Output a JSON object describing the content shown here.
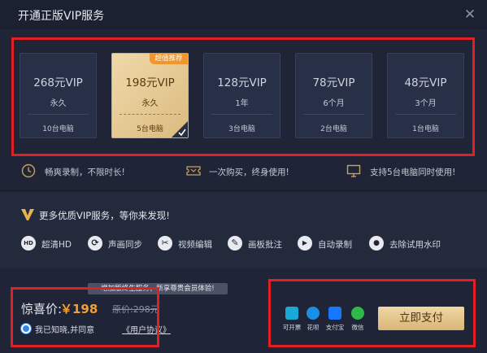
{
  "dialog": {
    "title": "开通正版VIP服务",
    "close_glyph": "✕"
  },
  "plans": [
    {
      "price": "268元VIP",
      "duration": "永久",
      "computers": "10台电脑",
      "selected": false
    },
    {
      "price": "198元VIP",
      "duration": "永久",
      "computers": "5台电脑",
      "selected": true,
      "badge": "超值推荐"
    },
    {
      "price": "128元VIP",
      "duration": "1年",
      "computers": "3台电脑",
      "selected": false
    },
    {
      "price": "78元VIP",
      "duration": "6个月",
      "computers": "2台电脑",
      "selected": false
    },
    {
      "price": "48元VIP",
      "duration": "3个月",
      "computers": "1台电脑",
      "selected": false
    }
  ],
  "highlights": [
    {
      "icon": "clock-icon",
      "text": "畅爽录制，不限时长!"
    },
    {
      "icon": "ticket-icon",
      "text": "一次购买，终身使用!"
    },
    {
      "icon": "monitor-icon",
      "text": "支持5台电脑同时使用!"
    }
  ],
  "more": {
    "title": "更多优质VIP服务，等你来发现!",
    "features": [
      {
        "icon": "hd-icon",
        "glyph": "HD",
        "label": "超清HD"
      },
      {
        "icon": "sync-icon",
        "glyph": "⟳",
        "label": "声画同步"
      },
      {
        "icon": "scissors-icon",
        "glyph": "✂",
        "label": "视频编辑"
      },
      {
        "icon": "brush-icon",
        "glyph": "✎",
        "label": "画板批注"
      },
      {
        "icon": "play-icon",
        "glyph": "▶",
        "label": "自动录制"
      },
      {
        "icon": "water-drop-icon",
        "glyph": "●",
        "label": "去除试用水印"
      }
    ]
  },
  "checkout": {
    "tooltip": "增加版终生服务，新享尊贵会员体验!",
    "surprise_label": "惊喜价:",
    "current_price": "￥198",
    "original_price": "原价:298元",
    "agree_text": "我已知晓,并同意",
    "agreement_link": "《用户协议》",
    "pay_methods": [
      {
        "icon": "kaipiao-icon",
        "label": "可开票",
        "color": "#1aa8d6"
      },
      {
        "icon": "huabei-icon",
        "label": "花呗",
        "color": "#1a8fe8"
      },
      {
        "icon": "alipay-icon",
        "label": "支付宝",
        "color": "#1677ff"
      },
      {
        "icon": "wechat-icon",
        "label": "微信",
        "color": "#2fb94a"
      }
    ],
    "pay_button": "立即支付"
  },
  "colors": {
    "accent_gold": "#d8b678",
    "price_orange": "#f2a032",
    "highlight_red": "#e11f24"
  }
}
